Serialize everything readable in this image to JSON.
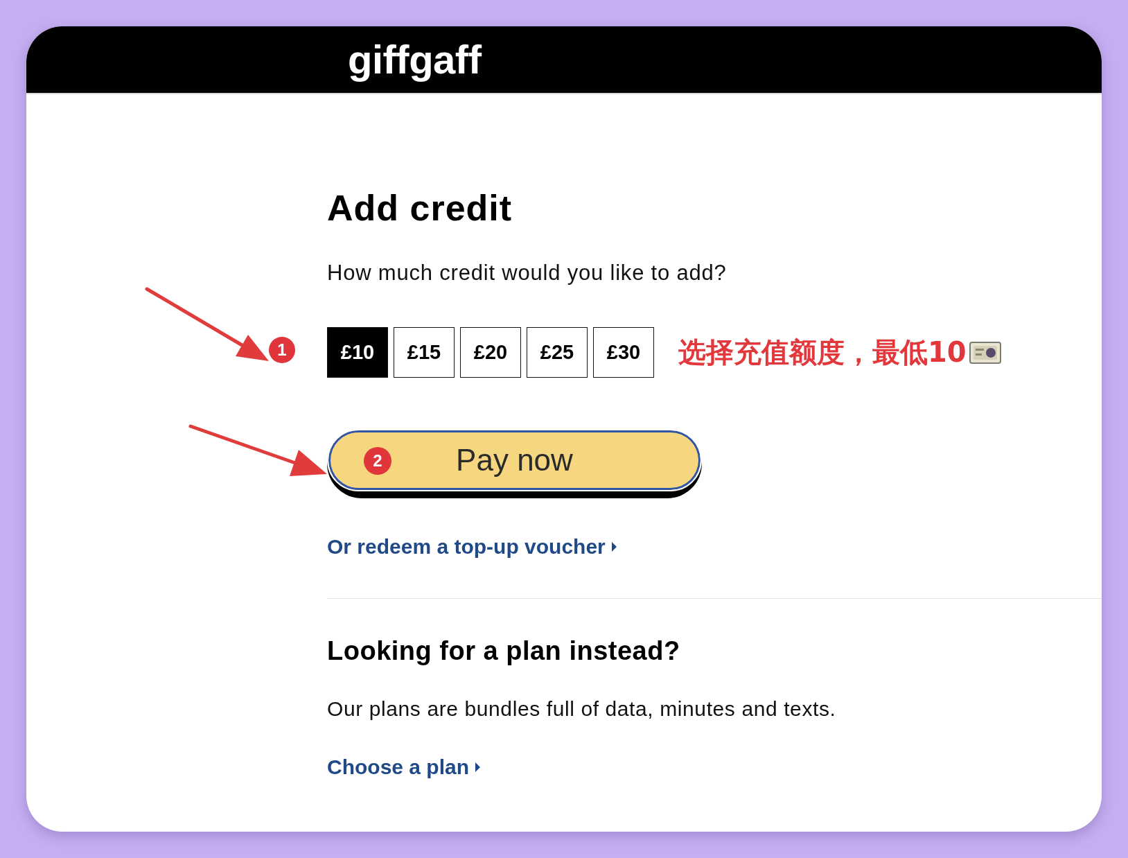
{
  "header": {
    "logo": "giffgaff"
  },
  "title": "Add credit",
  "prompt": "How much credit would you like to add?",
  "amounts": [
    {
      "label": "£10",
      "selected": true
    },
    {
      "label": "£15",
      "selected": false
    },
    {
      "label": "£20",
      "selected": false
    },
    {
      "label": "£25",
      "selected": false
    },
    {
      "label": "£30",
      "selected": false
    }
  ],
  "amount_note": "选择充值额度，最低10",
  "pay_button": {
    "label": "Pay now"
  },
  "voucher_link": {
    "label": "Or redeem a top-up voucher"
  },
  "plan_section": {
    "heading": "Looking for a plan instead?",
    "text": "Our plans are bundles full of data, minutes and texts.",
    "link": "Choose a plan"
  },
  "annotations": [
    {
      "badge": "1"
    },
    {
      "badge": "2"
    }
  ]
}
